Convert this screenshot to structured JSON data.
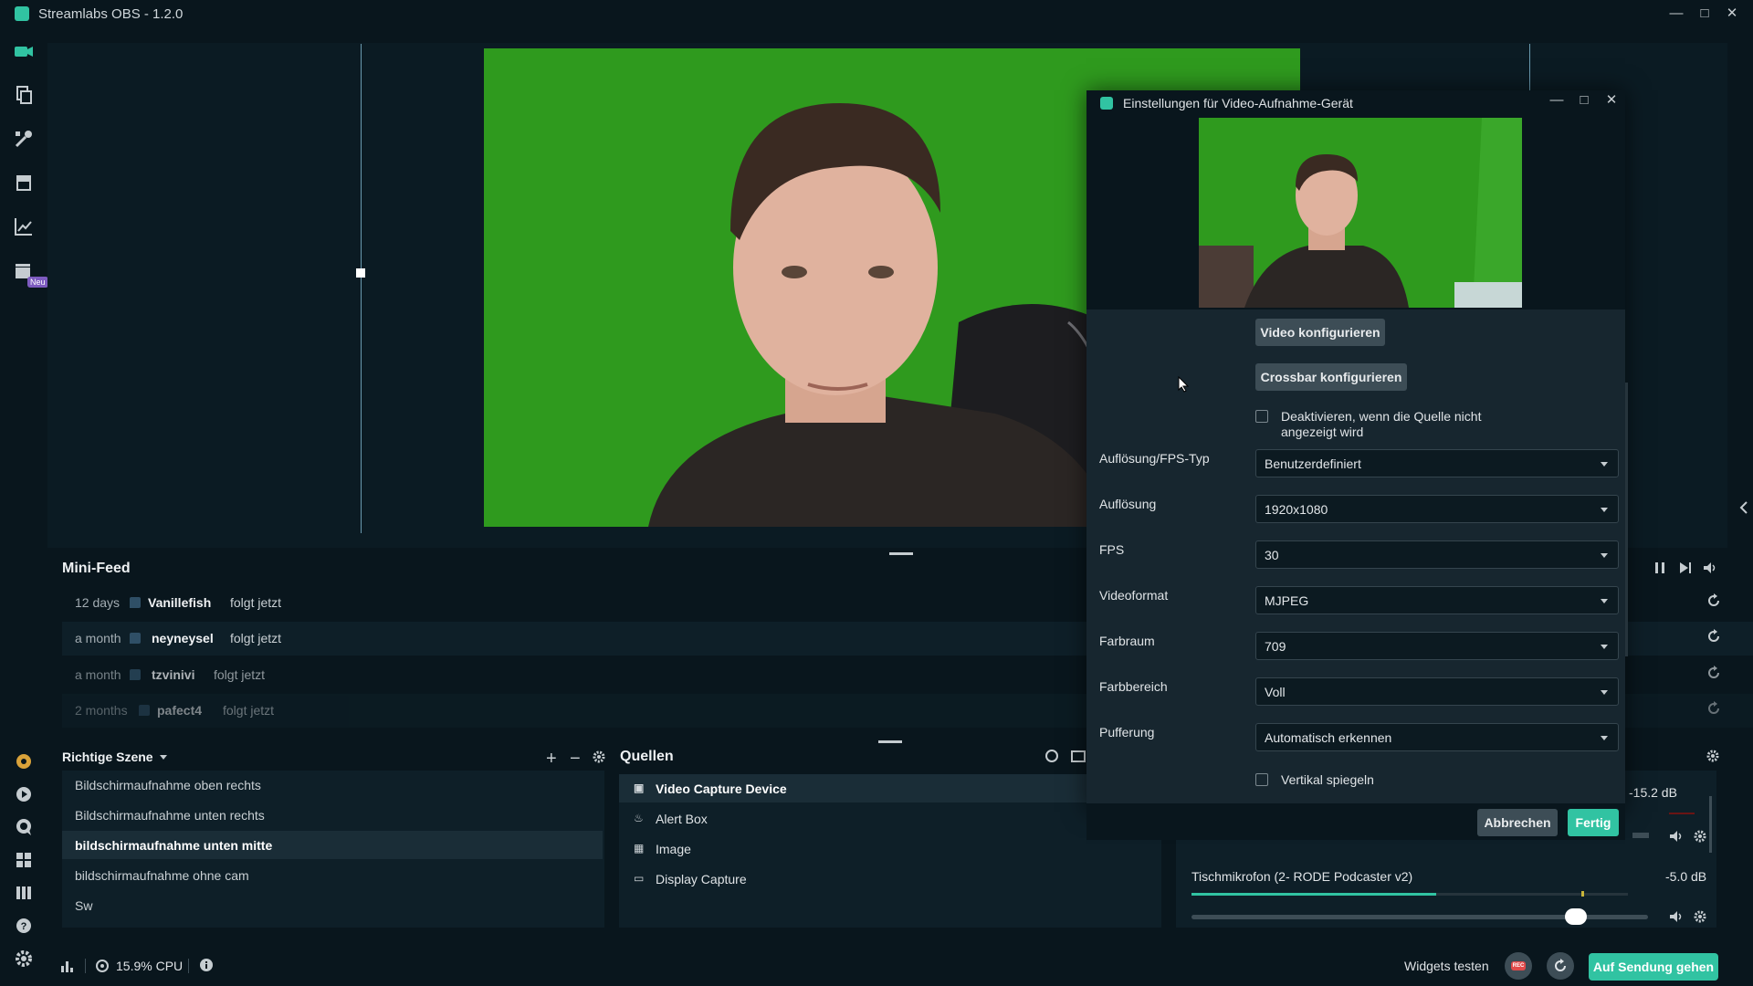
{
  "window": {
    "title": "Streamlabs OBS - 1.2.0",
    "minimize_icon": "minimize-icon",
    "maximize_icon": "maximize-icon",
    "close_icon": "close-icon"
  },
  "left_nav": {
    "items": [
      "editor-icon",
      "themes-icon",
      "widgets-icon",
      "store-icon",
      "dashboard-icon",
      "apps-icon"
    ],
    "badge": "Neu",
    "bottom_items": [
      "prime-icon",
      "play-icon",
      "chat-icon",
      "grid-icon",
      "columns-icon",
      "help-icon",
      "settings-icon"
    ]
  },
  "mini_feed": {
    "title": "Mini-Feed",
    "rows": [
      {
        "time": "12 days",
        "name": "Vanillefish",
        "action": "folgt jetzt"
      },
      {
        "time": "a month",
        "name": "neyneysel",
        "action": "folgt jetzt"
      },
      {
        "time": "a month",
        "name": "tzvinivi",
        "action": "folgt jetzt"
      },
      {
        "time": "2 months",
        "name": "pafect4",
        "action": "folgt jetzt"
      }
    ]
  },
  "scenes": {
    "title": "Richtige Szene",
    "items": [
      "Bildschirmaufnahme oben rechts",
      "Bildschirmaufnahme unten rechts",
      "bildschirmaufnahme unten mitte",
      "bildschirmaufnahme ohne cam",
      "Sw"
    ],
    "active_index": 2
  },
  "sources": {
    "title": "Quellen",
    "items": [
      {
        "label": "Video Capture Device",
        "icon": "camera-icon"
      },
      {
        "label": "Alert Box",
        "icon": "bell-icon"
      },
      {
        "label": "Image",
        "icon": "image-icon"
      },
      {
        "label": "Display Capture",
        "icon": "monitor-icon"
      }
    ]
  },
  "mixer": {
    "top_level": "-15.2 dB",
    "device_name": "Tischmikrofon (2- RODE Podcaster v2)",
    "device_level": "-5.0 dB",
    "device_meter_fraction": 0.56,
    "device_slider_fraction": 0.86,
    "colors": {
      "meter": "#31c3a2",
      "warn": "#c9b53a"
    }
  },
  "status_bar": {
    "cpu": "15.9% CPU",
    "widgets_test": "Widgets testen",
    "rec": "REC",
    "go_live": "Auf Sendung gehen"
  },
  "dialog": {
    "title": "Einstellungen für Video-Aufnahme-Gerät",
    "btn_video": "Video konfigurieren",
    "btn_crossbar": "Crossbar konfigurieren",
    "deactivate_label": "Deaktivieren, wenn die Quelle nicht angezeigt wird",
    "fields": [
      {
        "label": "Auflösung/FPS-Typ",
        "value": "Benutzerdefiniert"
      },
      {
        "label": "Auflösung",
        "value": "1920x1080"
      },
      {
        "label": "FPS",
        "value": "30"
      },
      {
        "label": "Videoformat",
        "value": "MJPEG"
      },
      {
        "label": "Farbraum",
        "value": "709"
      },
      {
        "label": "Farbbereich",
        "value": "Voll"
      },
      {
        "label": "Pufferung",
        "value": "Automatisch erkennen"
      }
    ],
    "flip_label": "Vertikal spiegeln",
    "btn_cancel": "Abbrechen",
    "btn_done": "Fertig"
  },
  "colors": {
    "accent": "#31c3a2",
    "green_screen": "#2f9a1e",
    "bg": "#09161d"
  }
}
